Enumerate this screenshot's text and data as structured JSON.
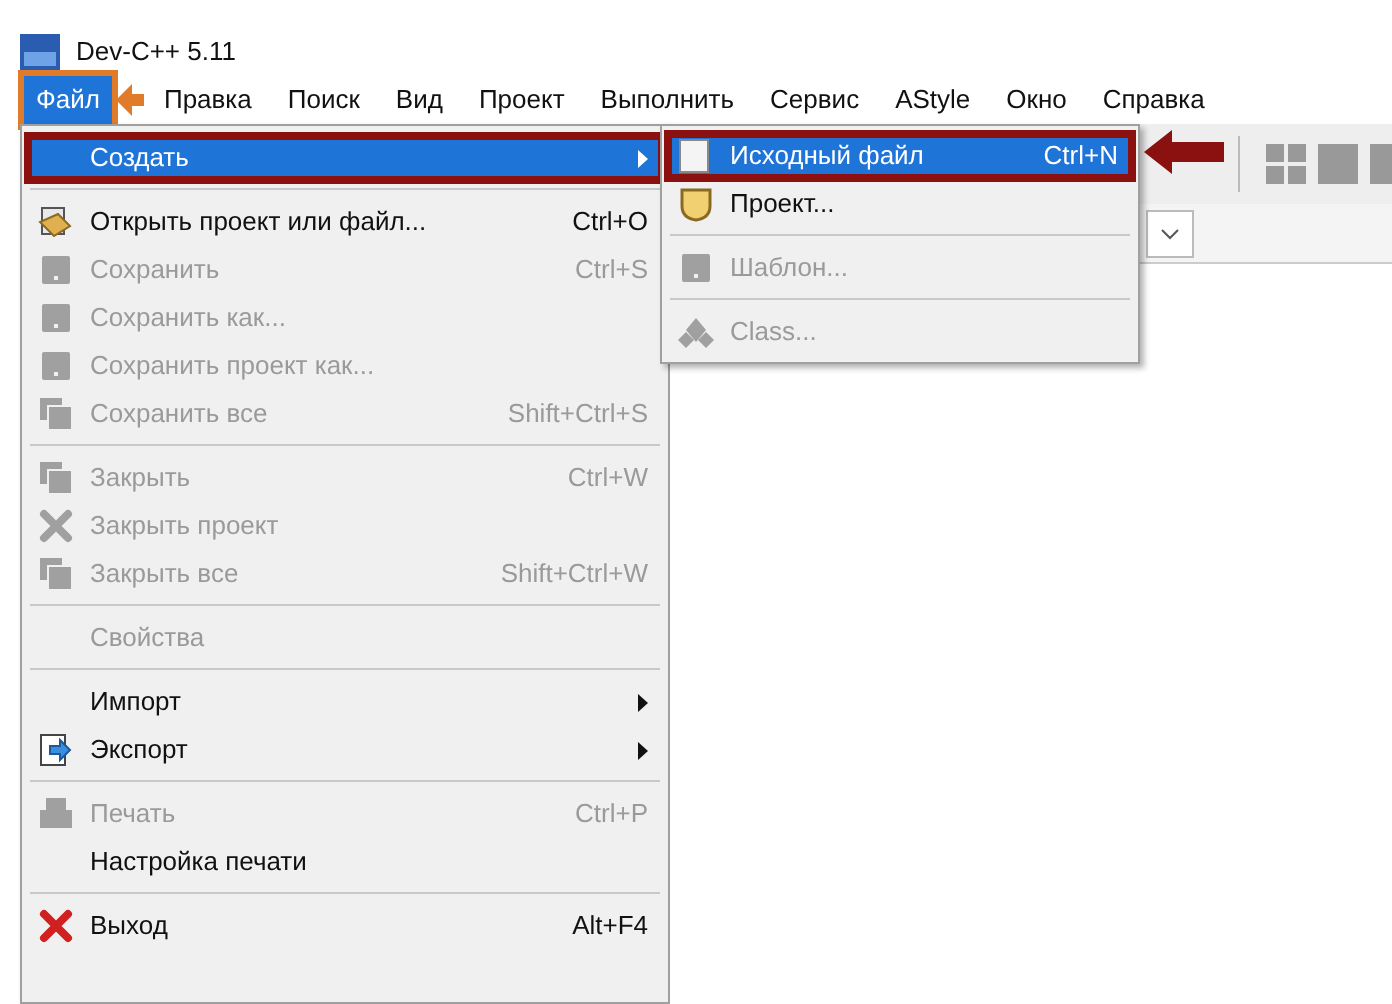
{
  "window": {
    "title": "Dev-C++ 5.11"
  },
  "menubar": [
    {
      "label": "Файл",
      "selected": true,
      "annotated": true
    },
    {
      "label": "Правка",
      "selected": false,
      "annotated": false
    },
    {
      "label": "Поиск",
      "selected": false,
      "annotated": false
    },
    {
      "label": "Вид",
      "selected": false,
      "annotated": false
    },
    {
      "label": "Проект",
      "selected": false,
      "annotated": false
    },
    {
      "label": "Выполнить",
      "selected": false,
      "annotated": false
    },
    {
      "label": "Сервис",
      "selected": false,
      "annotated": false
    },
    {
      "label": "AStyle",
      "selected": false,
      "annotated": false
    },
    {
      "label": "Окно",
      "selected": false,
      "annotated": false
    },
    {
      "label": "Справка",
      "selected": false,
      "annotated": false
    }
  ],
  "file_menu": [
    {
      "kind": "item",
      "label": "Создать",
      "submenu": true,
      "disabled": false,
      "selected": true,
      "annotated": true
    },
    {
      "kind": "separator"
    },
    {
      "kind": "item",
      "label": "Открыть проект или файл...",
      "shortcut": "Ctrl+O",
      "submenu": false,
      "disabled": false,
      "selected": false,
      "annotated": false
    },
    {
      "kind": "item",
      "label": "Сохранить",
      "shortcut": "Ctrl+S",
      "submenu": false,
      "disabled": true,
      "selected": false,
      "annotated": false
    },
    {
      "kind": "item",
      "label": "Сохранить как...",
      "submenu": false,
      "disabled": true,
      "selected": false,
      "annotated": false
    },
    {
      "kind": "item",
      "label": "Сохранить проект как...",
      "submenu": false,
      "disabled": true,
      "selected": false,
      "annotated": false
    },
    {
      "kind": "item",
      "label": "Сохранить все",
      "shortcut": "Shift+Ctrl+S",
      "submenu": false,
      "disabled": true,
      "selected": false,
      "annotated": false
    },
    {
      "kind": "separator"
    },
    {
      "kind": "item",
      "label": "Закрыть",
      "shortcut": "Ctrl+W",
      "submenu": false,
      "disabled": true,
      "selected": false,
      "annotated": false
    },
    {
      "kind": "item",
      "label": "Закрыть проект",
      "submenu": false,
      "disabled": true,
      "selected": false,
      "annotated": false
    },
    {
      "kind": "item",
      "label": "Закрыть все",
      "shortcut": "Shift+Ctrl+W",
      "submenu": false,
      "disabled": true,
      "selected": false,
      "annotated": false
    },
    {
      "kind": "separator"
    },
    {
      "kind": "item",
      "label": "Свойства",
      "submenu": false,
      "disabled": true,
      "selected": false,
      "annotated": false
    },
    {
      "kind": "separator"
    },
    {
      "kind": "item",
      "label": "Импорт",
      "submenu": true,
      "disabled": false,
      "selected": false,
      "annotated": false
    },
    {
      "kind": "item",
      "label": "Экспорт",
      "submenu": true,
      "disabled": false,
      "selected": false,
      "annotated": false
    },
    {
      "kind": "separator"
    },
    {
      "kind": "item",
      "label": "Печать",
      "shortcut": "Ctrl+P",
      "submenu": false,
      "disabled": true,
      "selected": false,
      "annotated": false
    },
    {
      "kind": "item",
      "label": "Настройка печати",
      "submenu": false,
      "disabled": false,
      "selected": false,
      "annotated": false
    },
    {
      "kind": "separator"
    },
    {
      "kind": "item",
      "label": "Выход",
      "shortcut": "Alt+F4",
      "submenu": false,
      "disabled": false,
      "selected": false,
      "annotated": false
    }
  ],
  "new_submenu": [
    {
      "kind": "item",
      "label": "Исходный файл",
      "shortcut": "Ctrl+N",
      "submenu": false,
      "disabled": false,
      "selected": true,
      "annotated": true
    },
    {
      "kind": "item",
      "label": "Проект...",
      "submenu": false,
      "disabled": false,
      "selected": false,
      "annotated": false
    },
    {
      "kind": "separator"
    },
    {
      "kind": "item",
      "label": "Шаблон...",
      "submenu": false,
      "disabled": true,
      "selected": false,
      "annotated": false
    },
    {
      "kind": "separator"
    },
    {
      "kind": "item",
      "label": "Class...",
      "submenu": false,
      "disabled": true,
      "selected": false,
      "annotated": false
    }
  ]
}
